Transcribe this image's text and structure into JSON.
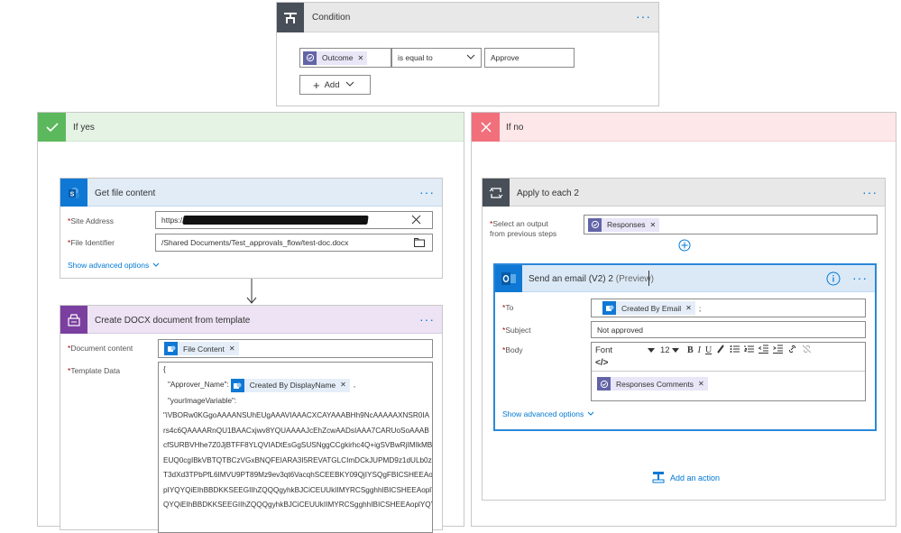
{
  "condition": {
    "title": "Condition",
    "token_label": "Outcome",
    "operator": "is equal to",
    "value": "Approve",
    "add_label": "Add"
  },
  "yes_branch": {
    "title": "If yes"
  },
  "no_branch": {
    "title": "If no"
  },
  "get_file": {
    "title": "Get file content",
    "site_address_label": "Site Address",
    "site_address_value": "https://",
    "file_identifier_label": "File Identifier",
    "file_identifier_value": "/Shared Documents/Test_approvals_flow/test-doc.docx",
    "advanced_label": "Show advanced options"
  },
  "create_docx": {
    "title": "Create DOCX document from template",
    "document_content_label": "Document content",
    "document_content_token": "File Content",
    "template_data_label": "Template Data",
    "template_lines": {
      "l0": "{",
      "l1_key": "\"Approver_Name\":",
      "l1_token": "Created By DisplayName",
      "l1_tail": ",",
      "l2": "\"yourImageVariable\":",
      "l3": "\"iVBORw0KGgoAAAANSUhEUgAAAVIAAACXCAYAAABHh9NcAAAAAXNSR0IA",
      "l4": "rs4c6QAAAARnQU1BAACxjwv8YQUAAAAJcEhZcwAADsIAAA7CARUoSoAAAB",
      "l5": "cfSURBVHhe7Z0JjBTFF8YLQVIADtEsGgSUSNggCCgkirhc4Q+igSVBwRjIMIkMB",
      "l6": "EUQ0cgIBkVBTQTBCzVGxBNQFEIARA3I5REVATGLCImDCkJUPMD9z1dULb0z3",
      "l7": "T3dXd3TPbPfL6IMVU9PT89Mz9ev3qt6VacqhSCEEBKY09QjIYSQgFBICSHEEAo",
      "l8": "pIYQYQiEIhBBDKKSEEGIIhZQQQgyhkBJCiCEUUkIIMYRCSgghhIBICSHEEAoplY",
      "l9": "QYQiEIhBBDKKSEEGIIhZQQQgyhkBJCiCEUUkIIMYRCSgghhIBICSHEEAoplYQY"
    }
  },
  "apply_each": {
    "title": "Apply to each 2",
    "select_label_1": "Select an output",
    "select_label_2": "from previous steps",
    "select_token": "Responses"
  },
  "send_email": {
    "title": "Send an email (V2) 2",
    "preview": "(Preview)",
    "to_label": "To",
    "to_token": "Created By Email",
    "to_tail": ";",
    "subject_label": "Subject",
    "subject_value": "Not approved",
    "body_label": "Body",
    "font_label": "Font",
    "font_size": "12",
    "body_token": "Responses Comments",
    "advanced_label": "Show advanced options"
  },
  "add_action_label": "Add an action",
  "required_mark": "*",
  "colors": {
    "accent": "#0078d4",
    "yes_green": "#5cb85c",
    "no_red": "#f1707b",
    "sharepoint": "#0f78d4",
    "template_purple": "#7b3fa0",
    "approvals_purple": "#6264a7",
    "outlook_blue": "#0f78d4",
    "condition_gray": "#484f58"
  }
}
